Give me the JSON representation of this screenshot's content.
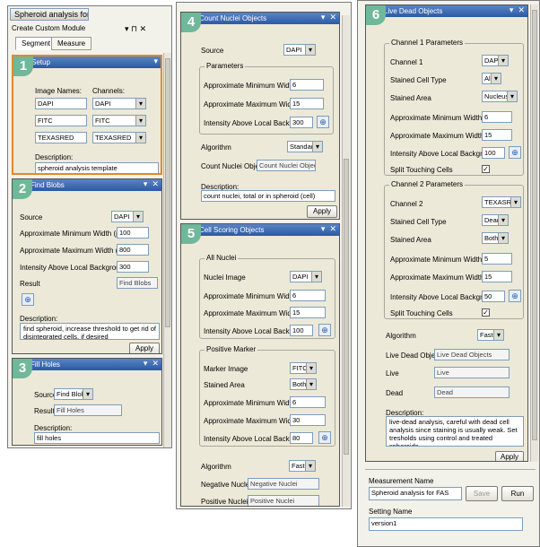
{
  "left": {
    "title": "Spheroid analysis for FAS",
    "module_title": "Create Custom Module",
    "tabs": [
      "Segment",
      "Measure"
    ],
    "step1": {
      "num": "1",
      "title": "Setup",
      "image_names_label": "Image Names:",
      "channels_label": "Channels:",
      "rows": [
        {
          "name": "DAPI",
          "channel": "DAPI"
        },
        {
          "name": "FITC",
          "channel": "FITC"
        },
        {
          "name": "TEXASRED",
          "channel": "TEXASRED"
        }
      ],
      "description_label": "Description:",
      "description": "spheroid analysis template"
    },
    "step2": {
      "num": "2",
      "title": "Find Blobs",
      "source_label": "Source",
      "source": "DAPI",
      "min_width_label": "Approximate Minimum Width (µm)",
      "min_width": "100",
      "max_width_label": "Approximate Maximum Width (µm)",
      "max_width": "800",
      "intensity_label": "Intensity Above Local Background",
      "intensity": "300",
      "result_label": "Result",
      "result": "Find Blobs",
      "description_label": "Description:",
      "description": "find spheroid, increase threshold to get rid of disintegrated cells, if desired",
      "apply": "Apply"
    },
    "step3": {
      "num": "3",
      "title": "Fill Holes",
      "source_label": "Source",
      "source": "Find Blobs",
      "result_label": "Result",
      "result": "Fill Holes",
      "description_label": "Description:",
      "description": "fill holes"
    }
  },
  "middle": {
    "step4": {
      "num": "4",
      "title": "Count Nuclei Objects",
      "source_label": "Source",
      "source": "DAPI",
      "params_label": "Parameters",
      "min_width_label": "Approximate Minimum Width (µm)",
      "min_width": "6",
      "max_width_label": "Approximate Maximum Width (µm)",
      "max_width": "15",
      "intensity_label": "Intensity Above Local Background",
      "intensity": "300",
      "algorithm_label": "Algorithm",
      "algorithm": "Standard",
      "count_label": "Count Nuclei Objects",
      "count_value": "Count Nuclei Objects",
      "description_label": "Description:",
      "description": "count nuclei, total or in spheroid (cell)",
      "apply": "Apply"
    },
    "step5": {
      "num": "5",
      "title": "Cell Scoring Objects",
      "all_nuclei_label": "All Nuclei",
      "nuclei_image_label": "Nuclei Image",
      "nuclei_image": "DAPI",
      "min_width_label": "Approximate Minimum Width (µm)",
      "min_width": "6",
      "max_width_label": "Approximate Maximum Width (µm)",
      "max_width": "15",
      "intensity_label": "Intensity Above Local Background",
      "intensity": "100",
      "positive_marker_label": "Positive Marker",
      "marker_image_label": "Marker Image",
      "marker_image": "FITC",
      "stained_area_label": "Stained Area",
      "stained_area": "Both",
      "pm_min_width": "6",
      "pm_max_width": "30",
      "pm_intensity": "80",
      "algorithm_label": "Algorithm",
      "algorithm": "Fast",
      "negative_label": "Negative Nuclei",
      "negative_value": "Negative Nuclei",
      "positive_label": "Positive Nuclei",
      "positive_value": "Positive Nuclei"
    }
  },
  "right": {
    "step6": {
      "num": "6",
      "title": "Live Dead Objects",
      "ch1_label": "Channel 1 Parameters",
      "channel1_label": "Channel 1",
      "channel1": "DAPI",
      "stained_type_label": "Stained Cell Type",
      "ch1_type": "All",
      "stained_area_label": "Stained Area",
      "ch1_area": "Nucleus",
      "min_width_label": "Approximate Minimum Width (µm)",
      "ch1_min": "6",
      "max_width_label": "Approximate Maximum Width (µm)",
      "ch1_max": "15",
      "intensity_label": "Intensity Above Local Background",
      "ch1_int": "100",
      "split_label": "Split Touching Cells",
      "ch2_label": "Channel 2 Parameters",
      "channel2_label": "Channel 2",
      "channel2": "TEXASRED",
      "ch2_type": "Dead",
      "ch2_area": "Both",
      "ch2_min": "5",
      "ch2_max": "15",
      "ch2_int": "50",
      "algorithm_label": "Algorithm",
      "algorithm": "Fast",
      "ldo_label": "Live Dead Objects",
      "ldo_value": "Live Dead Objects",
      "live_label": "Live",
      "live_value": "Live",
      "dead_label": "Dead",
      "dead_value": "Dead",
      "description_label": "Description:",
      "description": "live-dead analysis, careful with dead cell analysis since staining is usually weak. Set tresholds using control and treated spheroids",
      "apply": "Apply"
    },
    "measurement_label": "Measurement Name",
    "measurement_value": "Spheroid analysis for FAS",
    "save": "Save",
    "run": "Run",
    "setting_label": "Setting Name",
    "setting_value": "version1"
  },
  "colors": {
    "header": "#2a5aa5",
    "badge": "#6fb89a",
    "panel": "#ece9d8",
    "accent": "#e08a2c"
  }
}
